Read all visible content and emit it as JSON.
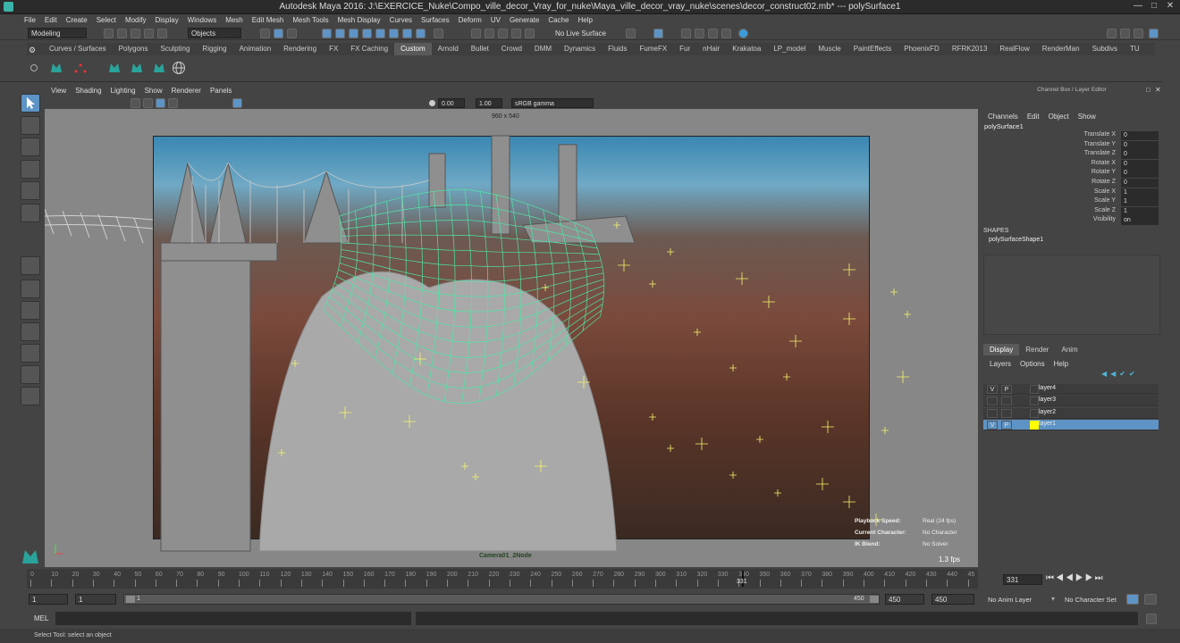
{
  "window": {
    "title": "Autodesk Maya 2016: J:\\EXERCICE_Nuke\\Compo_ville_decor_Vray_for_nuke\\Maya_ville_decor_vray_nuke\\scenes\\decor_construct02.mb*   ---   polySurface1"
  },
  "menubar": {
    "items": [
      "File",
      "Edit",
      "Create",
      "Select",
      "Modify",
      "Display",
      "Windows",
      "Mesh",
      "Edit Mesh",
      "Mesh Tools",
      "Mesh Display",
      "Curves",
      "Surfaces",
      "Deform",
      "UV",
      "Generate",
      "Cache",
      "Help"
    ]
  },
  "statusline": {
    "mode": "Modeling",
    "objects": "Objects",
    "live_surface": "No Live Surface"
  },
  "shelf": {
    "tabs": [
      "Curves / Surfaces",
      "Polygons",
      "Sculpting",
      "Rigging",
      "Animation",
      "Rendering",
      "FX",
      "FX Caching",
      "Custom",
      "Arnold",
      "Bullet",
      "Crowd",
      "DMM",
      "Dynamics",
      "Fluids",
      "FumeFX",
      "Fur",
      "nHair",
      "Krakatoa",
      "LP_model",
      "Muscle",
      "PaintEffects",
      "PhoenixFD",
      "RFRK2013",
      "RealFlow",
      "RenderMan",
      "Subdivs",
      "TU"
    ],
    "active_tab": "Custom"
  },
  "viewport": {
    "menu": [
      "View",
      "Shading",
      "Lighting",
      "Show",
      "Renderer",
      "Panels"
    ],
    "exposure": "0.00",
    "gamma": "1.00",
    "color_space": "sRGB gamma",
    "resolution": "960 x 540",
    "camera": "Camera01_2Node",
    "fps": "1.3 fps",
    "hud": [
      {
        "label": "Playback Speed:",
        "value": "Real (24 fps)"
      },
      {
        "label": "Current Character:",
        "value": "No Character"
      },
      {
        "label": "IK Blend:",
        "value": "No Solver"
      }
    ]
  },
  "channelbox": {
    "header": "Channel Box / Layer Editor",
    "menu": [
      "Channels",
      "Edit",
      "Object",
      "Show"
    ],
    "object": "polySurface1",
    "attrs": [
      {
        "name": "Translate X",
        "value": "0"
      },
      {
        "name": "Translate Y",
        "value": "0"
      },
      {
        "name": "Translate Z",
        "value": "0"
      },
      {
        "name": "Rotate X",
        "value": "0"
      },
      {
        "name": "Rotate Y",
        "value": "0"
      },
      {
        "name": "Rotate Z",
        "value": "0"
      },
      {
        "name": "Scale X",
        "value": "1"
      },
      {
        "name": "Scale Y",
        "value": "1"
      },
      {
        "name": "Scale Z",
        "value": "1"
      },
      {
        "name": "Visibility",
        "value": "on"
      }
    ],
    "shapes_header": "SHAPES",
    "shape": "polySurfaceShape1"
  },
  "layers": {
    "tabs": [
      "Display",
      "Render",
      "Anim"
    ],
    "active_tab": "Display",
    "menu": [
      "Layers",
      "Options",
      "Help"
    ],
    "items": [
      {
        "name": "layer4",
        "v": "V",
        "p": "P"
      },
      {
        "name": "layer3",
        "v": "",
        "p": ""
      },
      {
        "name": "layer2",
        "v": "",
        "p": ""
      },
      {
        "name": "layer1",
        "v": "V",
        "p": "P"
      }
    ]
  },
  "timeline": {
    "ticks": [
      "0",
      "10",
      "20",
      "30",
      "40",
      "50",
      "60",
      "70",
      "80",
      "90",
      "100",
      "110",
      "120",
      "130",
      "140",
      "150",
      "160",
      "170",
      "180",
      "190",
      "200",
      "210",
      "220",
      "230",
      "240",
      "250",
      "260",
      "270",
      "280",
      "290",
      "300",
      "310",
      "320",
      "330",
      "340",
      "350",
      "360",
      "370",
      "380",
      "390",
      "400",
      "410",
      "420",
      "430",
      "440",
      "45"
    ],
    "current_frame": "331",
    "current_field": "331"
  },
  "range": {
    "start": "1",
    "start2": "1",
    "inner_start": "1",
    "inner_end": "450",
    "end": "450",
    "end2": "450",
    "anim_layer": "No Anim Layer",
    "char_set": "No Character Set"
  },
  "cmdline": {
    "label": "MEL"
  },
  "helpline": {
    "text": "Select Tool: select an object"
  },
  "colors": {
    "accent": "#5e93c5",
    "wire": "#4ee6a6",
    "locator": "#f5f56a"
  }
}
